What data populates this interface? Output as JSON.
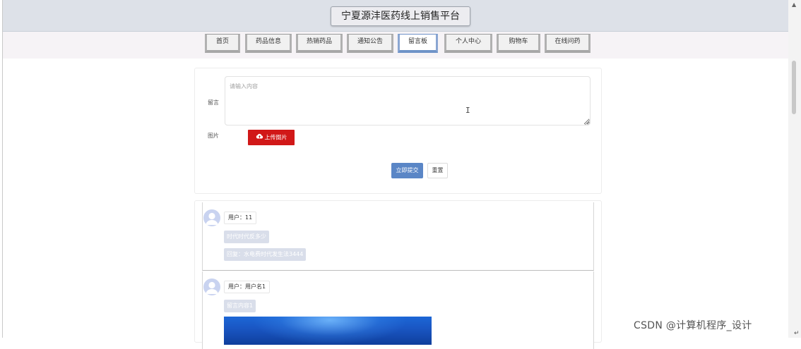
{
  "header": {
    "title": "宁夏源沣医药线上销售平台"
  },
  "nav": {
    "tabs": [
      {
        "label": "首页",
        "active": false
      },
      {
        "label": "药品信息",
        "active": false
      },
      {
        "label": "热销药品",
        "active": false
      },
      {
        "label": "通知公告",
        "active": false
      },
      {
        "label": "留言板",
        "active": true
      },
      {
        "label": "个人中心",
        "active": false
      },
      {
        "label": "购物车",
        "active": false
      },
      {
        "label": "在线问药",
        "active": false
      }
    ]
  },
  "form": {
    "message_label": "留言",
    "message_placeholder": "请输入内容",
    "message_value": "",
    "image_label": "图片",
    "upload_label": "上传图片",
    "submit_label": "立即提交",
    "reset_label": "重置"
  },
  "messages": [
    {
      "user": "用户：11",
      "content": "时代时代反多少",
      "reply": "回复：水电费时代发生法3444",
      "has_image": false
    },
    {
      "user": "用户：用户名1",
      "content": "留言内容1",
      "has_image": true
    }
  ],
  "watermark": "CSDN @计算机程序_设计",
  "colors": {
    "header_bg": "#dde1e8",
    "upload_btn": "#d11818",
    "submit_btn": "#5a86c6",
    "active_tab_border": "#6f93c8",
    "bubble_bg": "#d9deea"
  }
}
